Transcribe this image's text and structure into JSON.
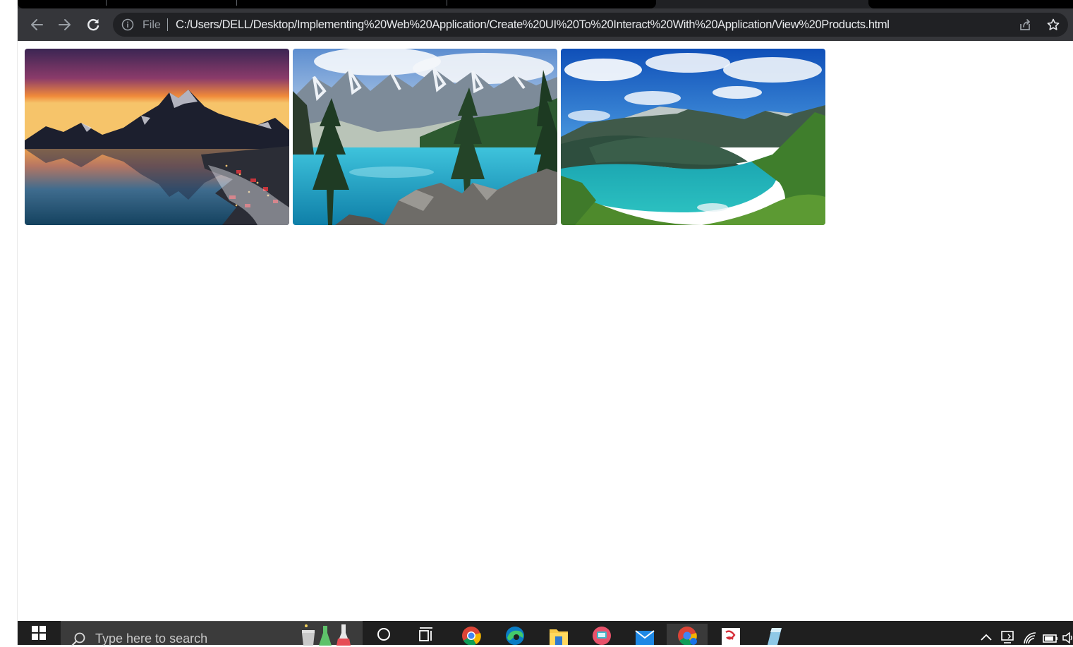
{
  "browser": {
    "address_scheme_label": "File",
    "url": "C:/Users/DELL/Desktop/Implementing%20Web%20Application/Create%20UI%20To%20Interact%20With%20Application/View%20Products.html",
    "icons": [
      "back-arrow-icon",
      "forward-arrow-icon",
      "reload-icon",
      "info-icon",
      "share-icon",
      "star-icon"
    ]
  },
  "gallery": {
    "images": [
      {
        "subject": "lofoten-sunset",
        "colors": [
          "#3e2a5c",
          "#f08a3a",
          "#1d5e86"
        ]
      },
      {
        "subject": "moraine-lake",
        "colors": [
          "#8fb3d9",
          "#19a7c9",
          "#2c4a2a"
        ]
      },
      {
        "subject": "geiranger-fjord",
        "colors": [
          "#1f6fd0",
          "#2bb5b8",
          "#4e8a2c"
        ]
      }
    ]
  },
  "taskbar": {
    "search_placeholder": "Type here to search",
    "icons": [
      "windows-start-icon",
      "search-icon",
      "lab-flasks-icon",
      "cortana-icon",
      "task-view-icon",
      "chrome-icon",
      "edge-icon",
      "file-explorer-icon",
      "media-app-icon",
      "mail-icon",
      "chrome-profile-icon",
      "app-tile-icon",
      "notepad-icon",
      "chevron-up-icon",
      "network-icon",
      "wifi-icon",
      "battery-icon",
      "volume-icon"
    ]
  },
  "colors": {
    "toolbar": "#35363a",
    "omnibox": "#202124",
    "taskbar": "#1f1f1f"
  }
}
